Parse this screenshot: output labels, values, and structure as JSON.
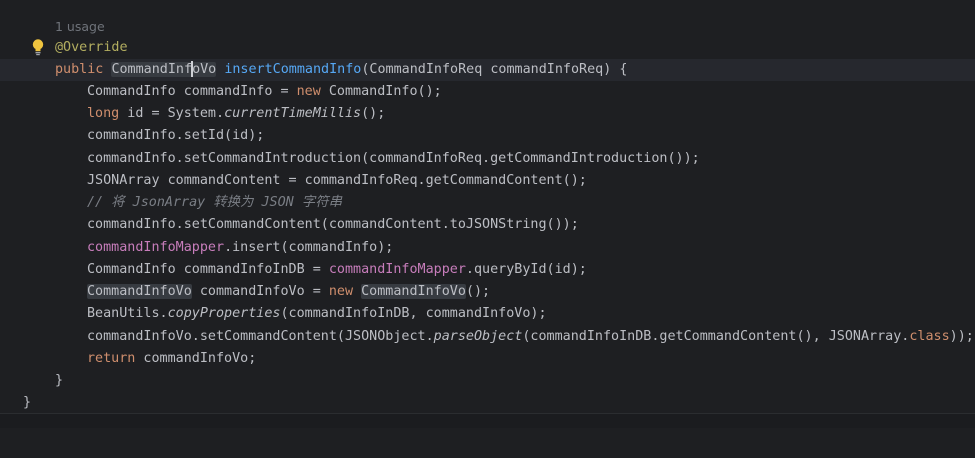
{
  "editor": {
    "usage_hint": "1 usage",
    "gutter": {
      "bulb_icon": "lightbulb-icon",
      "override_icon": "implements-override-icon"
    },
    "code": {
      "annotation": "@Override",
      "l2_public": "public",
      "l2_ret_a": "CommandInf",
      "l2_ret_b": "oVo",
      "l2_method": "insertCommandInfo",
      "l2_params": "(CommandInfoReq commandInfoReq) {",
      "l3_a": "CommandInfo commandInfo = ",
      "l3_new": "new",
      "l3_b": " CommandInfo();",
      "l4_long": "long",
      "l4_a": " id = System.",
      "l4_m": "currentTimeMillis",
      "l4_b": "();",
      "l5": "commandInfo.setId(id);",
      "l6": "commandInfo.setCommandIntroduction(commandInfoReq.getCommandIntroduction());",
      "l7": "JSONArray commandContent = commandInfoReq.getCommandContent();",
      "l8_comment": "// 将 JsonArray 转换为 JSON 字符串",
      "l9": "commandInfo.setCommandContent(commandContent.toJSONString());",
      "l10_field": "commandInfoMapper",
      "l10_b": ".insert(commandInfo);",
      "l11_a": "CommandInfo commandInfoInDB = ",
      "l11_field": "commandInfoMapper",
      "l11_b": ".queryById(id);",
      "l12_type": "CommandInfoVo",
      "l12_a": " commandInfoVo = ",
      "l12_new": "new",
      "l12_type2": "CommandInfoVo",
      "l12_b": "();",
      "l13_a": "BeanUtils.",
      "l13_m": "copyProperties",
      "l13_b": "(commandInfoInDB, commandInfoVo);",
      "l14_a": "commandInfoVo.setCommandContent(JSONObject.",
      "l14_m": "parseObject",
      "l14_b": "(commandInfoInDB.getCommandContent(), JSONArray.",
      "l14_class": "class",
      "l14_c": "));",
      "l15_return": "return",
      "l15_b": " commandInfoVo;",
      "l16": "}",
      "l17": "}"
    }
  }
}
